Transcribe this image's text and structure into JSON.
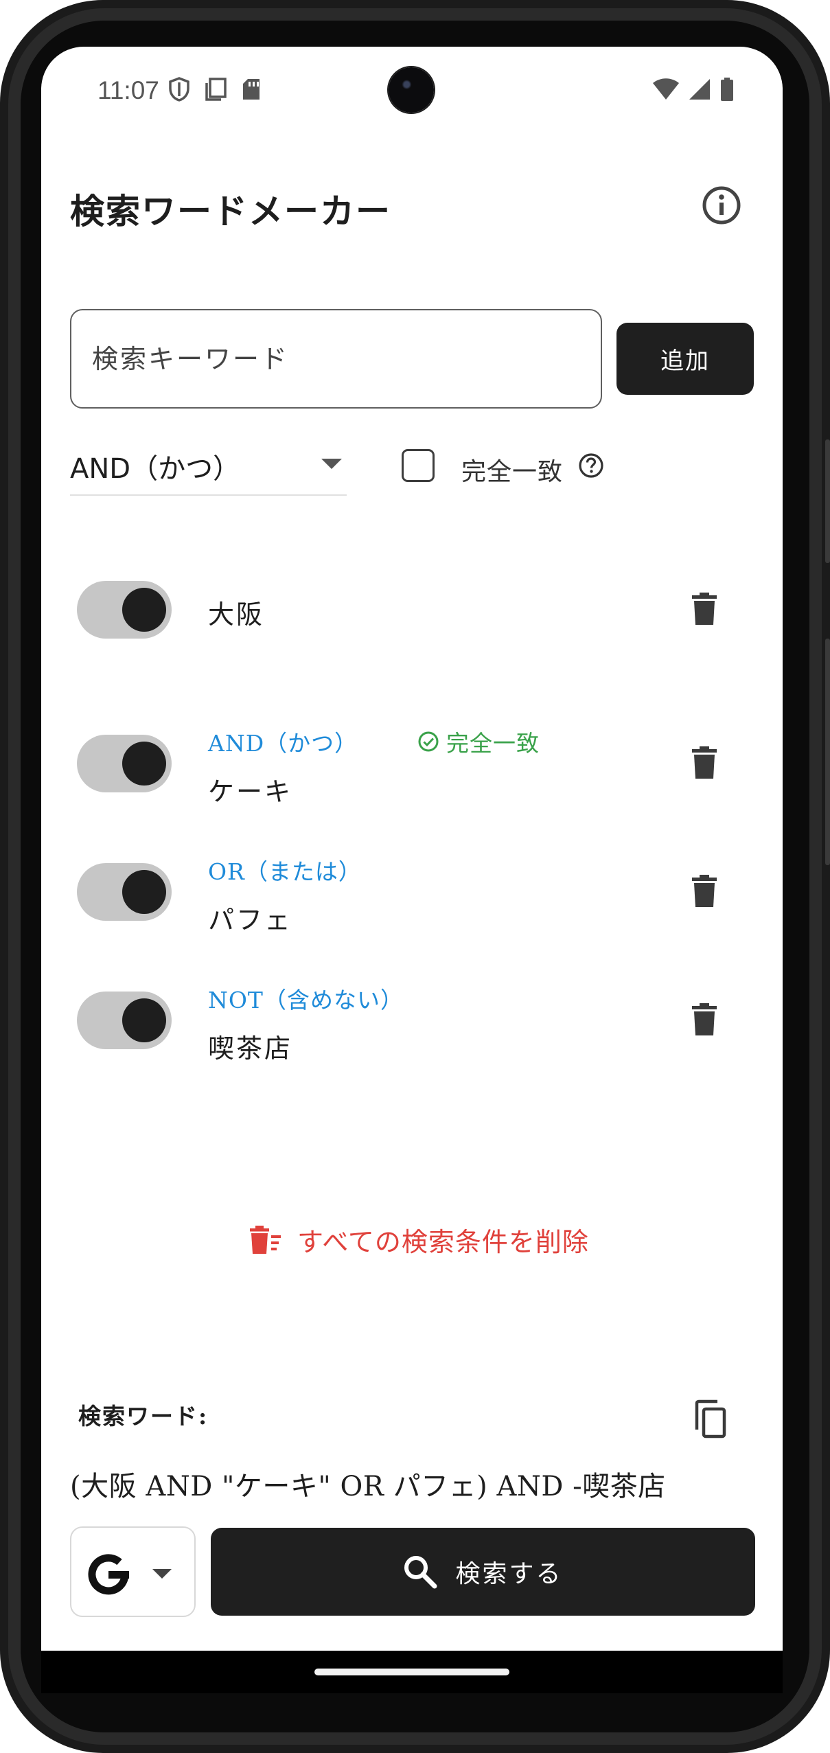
{
  "status_bar": {
    "time": "11:07",
    "left_icons": [
      "shield-icon",
      "screenshot-icon",
      "sd-card-icon"
    ],
    "right_icons": [
      "wifi-icon",
      "signal-icon",
      "battery-icon"
    ]
  },
  "app_bar": {
    "title": "検索ワードメーカー",
    "info_icon": "info-icon"
  },
  "input": {
    "placeholder": "検索キーワード",
    "value": "",
    "add_label": "追加"
  },
  "options": {
    "operator_selected": "AND（かつ）",
    "exact_match_label": "完全一致",
    "exact_match_checked": false
  },
  "conditions": [
    {
      "enabled": true,
      "operator": "",
      "exact": false,
      "exact_label": "",
      "word": "大阪"
    },
    {
      "enabled": true,
      "operator": "AND（かつ）",
      "exact": true,
      "exact_label": "完全一致",
      "word": "ケーキ"
    },
    {
      "enabled": true,
      "operator": "OR（または）",
      "exact": false,
      "exact_label": "",
      "word": "パフェ"
    },
    {
      "enabled": true,
      "operator": "NOT（含めない）",
      "exact": false,
      "exact_label": "",
      "word": "喫茶店"
    }
  ],
  "delete_all_label": "すべての検索条件を削除",
  "query": {
    "label": "検索ワード:",
    "text": "(大阪 AND \"ケーキ\" OR パフェ) AND -喫茶店"
  },
  "bottom": {
    "engine": "Google",
    "search_label": "検索する"
  },
  "colors": {
    "operator_blue": "#1f8bd9",
    "exact_green": "#3aa24a",
    "delete_red": "#e0413b",
    "dark_button": "#1f1f1f"
  }
}
